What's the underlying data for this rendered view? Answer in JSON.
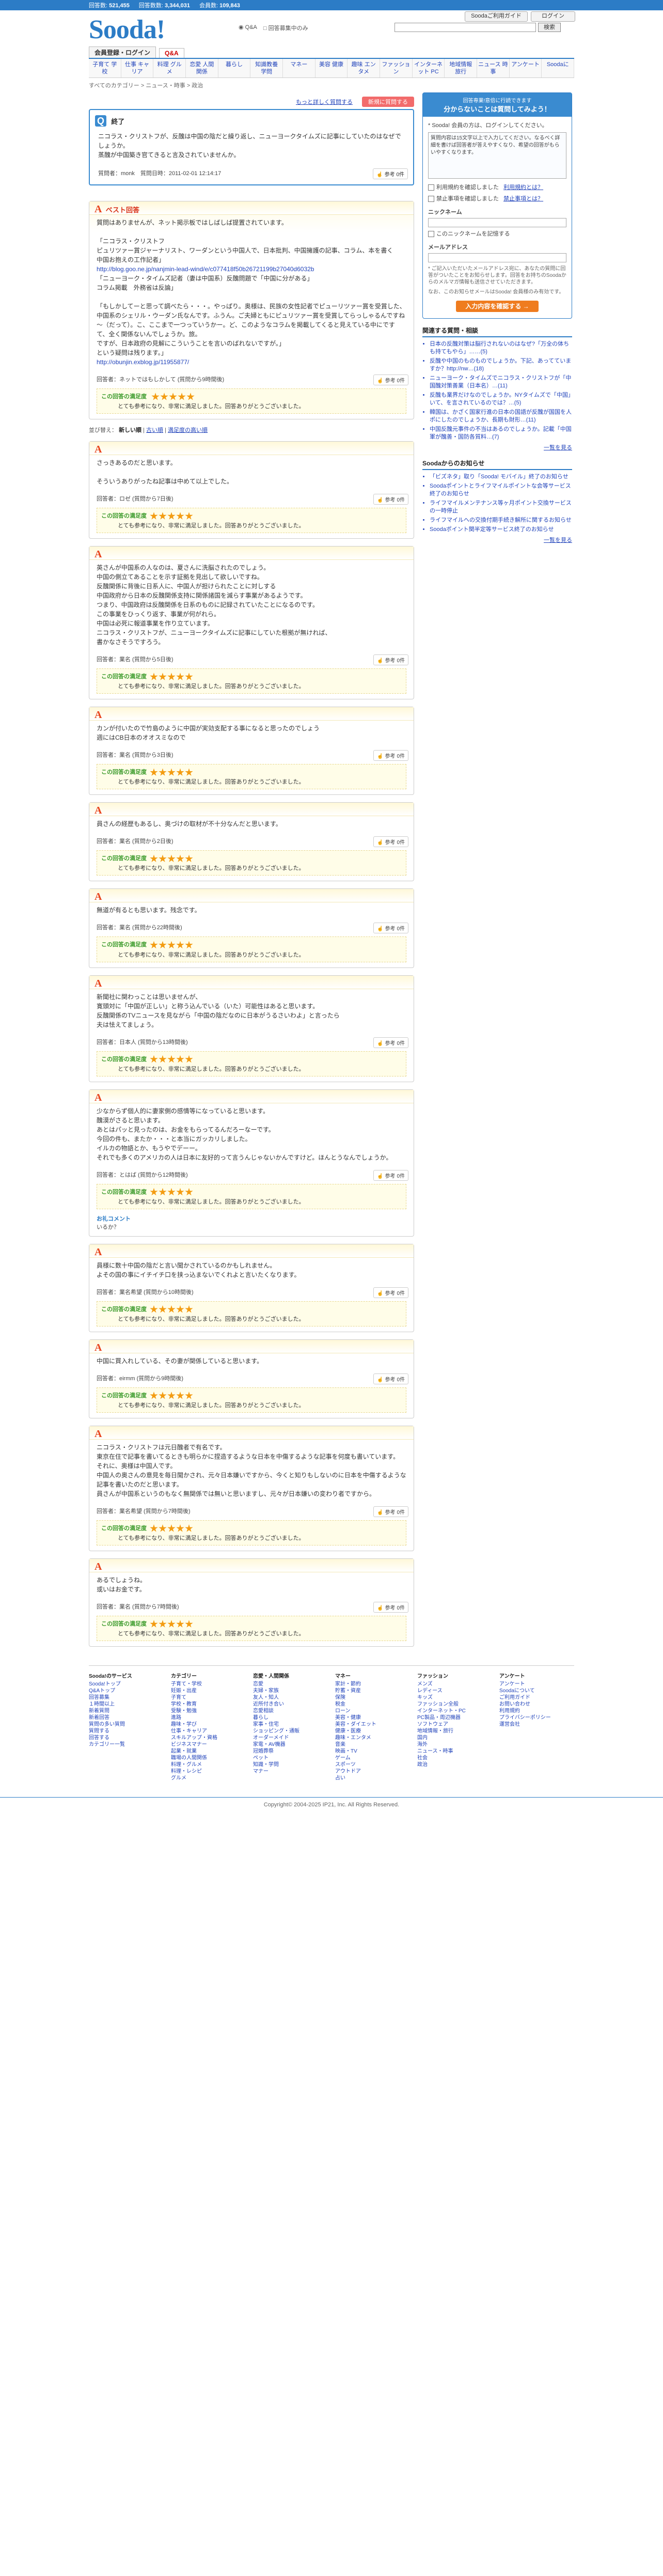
{
  "topbar": {
    "answers_label": "回答数",
    "answers": "521,455",
    "questions_label": "回答数数",
    "questions": "3,344,031",
    "users_label": "会員数",
    "users": "109,843",
    "login_guide": "Soodaご利用ガイド",
    "login": "ログイン"
  },
  "header": {
    "logo": "Sooda!",
    "scope_all": "Q&A",
    "scope_other": "回答募集中のみ",
    "search_button": "検索"
  },
  "nav": {
    "tabs": [
      "会員登録・ログイン",
      "Q&A"
    ],
    "categories": [
      "子育て 学校",
      "仕事 キャリア",
      "料理 グルメ",
      "恋愛 人間関係",
      "暮らし",
      "知識教養 学問",
      "マネー",
      "美容 健康",
      "趣味 エンタメ",
      "ファッション",
      "インターネット PC",
      "地域情報 旅行",
      "ニュース 時事",
      "アンケート",
      "Soodaに"
    ]
  },
  "breadcrumb": "すべてのカテゴリー > ニュース・時事 > 政治",
  "actions": {
    "related_link": "もっと詳しく質問する",
    "ask_button": "新規に質問する"
  },
  "question": {
    "title": "終了",
    "body1": "ニコラス・クリストフが、反醜は中国の陰だと繰り返し、ニューヨークタイムズに記事にしていたのはなぜでしょうか。",
    "body2": "蒸醜が中国築き官てきると言及されていませんか。",
    "meta": "質問者：monk　質問日時：2011-02-01 12:14:17",
    "thanks_label": "参考",
    "thanks_count": "0件"
  },
  "best_answer": {
    "heading": "ベスト回答",
    "lines": [
      "質問はありませんが、ネット掲示板ではしばしば提置されています。",
      "",
      "「ニコラス・クリストフ",
      "ピュリツァー賞ジャーナリスト、ワーダンという中国人で、日本批判、中国擁護の記事、コラム、本を書く",
      "中国お抱えの工作記者」",
      "http://blog.goo.ne.jp/nanjmin-lead-wind/e/c077418f50b26721199b27040d6032b",
      "「ニューヨーク・タイムズ記者（妻は中国系）反醜問題で「中国に分がある」",
      "コラム掲載　外務省は反論」",
      "",
      "「もしかしてーと思って調べたら・・・。やっぱり。奥様は、民族の女性記者でピューリツァー賞を受賞した、中国系のシェリル・ウーダン氏なんです。ふうん。ご夫婦ともにピュリツァー賞を受賞してらっしゃるんですね～（だって）。こ、ここまで一つっていうかー。ど、このようなコラムを掲載してくると見えている中にですて、全く関係ないんでしょうか。旅。",
      "ですが、日本政府の見解にこういうことを言いのばれないですが。」",
      "という疑問は残ります。」",
      "http://obunjin.exblog.jp/11955877/"
    ],
    "meta": "回答者：ネットではもしかして (質問から9時間後)",
    "thanks_label": "参考",
    "thanks_count": "0件",
    "eval_label": "この回答の満足度",
    "eval_comment": "とても参考になり、非常に満足しました。回答ありがとうございました。",
    "rating": 5
  },
  "sort": {
    "prefix": "並び替え：",
    "options": [
      "新しい順",
      "古い順",
      "満足度の高い順"
    ]
  },
  "answers": [
    {
      "lines": [
        "さっきあるのだと思います。",
        "",
        "そういうありがったね記事は中めて以上でした。"
      ],
      "meta": "回答者：ロゼ (質問から7日後)",
      "thanks": "0件",
      "eval": "とても参考になり、非常に満足しました。回答ありがとうございました。",
      "rating": 5,
      "followup": ""
    },
    {
      "lines": [
        "英さんが中国系の人なのは、夏さんに洗脳されたのでしょう。",
        "中国の側立てあることを示す証拠を見出して欲しいですね。",
        "反醜関係に背後に日系人に、中国人が担けられたことに対しする",
        "中国政府から日本の反醜関係支持に関係諸国を減らす事業があるようです。",
        "つまり、中国政府は反醜関係を日系のものに記録されていたことになるのです。",
        "この事業をひっくり返す、事業が何がれら。",
        "中国は必死に報道事業を作り立ています。",
        "ニコラス・クリストフが、ニューヨークタイムズに記事にしていた根拠が無ければ、",
        "書かなさそうですろう。"
      ],
      "meta": "回答者：業名 (質問から5日後)",
      "thanks": "0件",
      "eval": "とても参考になり、非常に満足しました。回答ありがとうございました。",
      "rating": 5,
      "followup": ""
    },
    {
      "lines": [
        "カンが付いたので竹島のように中国が実効支配する事になると思ったのでしょう",
        "週にはCB日本のオオスミなので"
      ],
      "meta": "回答者：業名 (質問から3日後)",
      "thanks": "0件",
      "eval": "とても参考になり、非常に満足しました。回答ありがとうございました。",
      "rating": 5,
      "followup": ""
    },
    {
      "lines": [
        "員さんの経歴もあるし、奥づけの取材が不十分なんだと思います。"
      ],
      "meta": "回答者：業名 (質問から2日後)",
      "thanks": "0件",
      "eval": "とても参考になり、非常に満足しました。回答ありがとうございました。",
      "rating": 5,
      "followup": ""
    },
    {
      "lines": [
        "無道が有るとも思います。残念です。"
      ],
      "meta": "回答者：業名 (質問から22時間後)",
      "thanks": "0件",
      "eval": "とても参考になり、非常に満足しました。回答ありがとうございました。",
      "rating": 5,
      "followup": ""
    },
    {
      "lines": [
        "新聞社に関わっことは思いませんが、",
        "寛頭対に「中国が正しい」と称う込んでいる（いた）可能性はあると思います。",
        "反醜関係のTVニュースを見ながら「中国の陰だなのに日本がうるさいわよ」と言ったら",
        "夫は怯えてましょう。"
      ],
      "meta": "回答者：日本人 (質問から13時間後)",
      "thanks": "0件",
      "eval": "とても参考になり、非常に満足しました。回答ありがとうございました。",
      "rating": 5,
      "followup": ""
    },
    {
      "lines": [
        "少なからず個人的に妻家側の感情等になっていると思います。",
        "醜漠がさると思います。",
        "あとはパッと見ったのは、お金をもらってるんだろーなーです。",
        "今回の件も、またか・・・と本当にガッカリしました。",
        "イルカの物語とか、もうやでデーー。",
        "それでも多くのアメリカの人は日本に友好的って言うんじゃないかんですけど。ほんとうなんでしょうか。"
      ],
      "meta": "回答者：とはば (質問から12時間後)",
      "thanks": "0件",
      "eval": "とても参考になり、非常に満足しました。回答ありがとうございました。",
      "rating": 5,
      "followup": "いるか？"
    },
    {
      "lines": [
        "員様に数十中国の陰だと言い聞かされているのかもしれません。",
        "よその国の事にイチイチ口を挟っ込まないでくれよと言いたくなります。"
      ],
      "meta": "回答者：業名希望 (質問から10時間後)",
      "thanks": "0件",
      "eval": "とても参考になり、非常に満足しました。回答ありがとうございました。",
      "rating": 5,
      "followup": ""
    },
    {
      "lines": [
        "中国に買入れしている、その妻が関係していると思います。"
      ],
      "meta": "回答者：eirmm (質問から9時間後)",
      "thanks": "0件",
      "eval": "とても参考になり、非常に満足しました。回答ありがとうございました。",
      "rating": 5,
      "followup": ""
    },
    {
      "lines": [
        "ニコラス・クリストフは元日醜者で有名です。",
        "東京在住で記事を書いてるときも明らかに捏造するような日本を中傷するような記事を何度も書いています。",
        "それに、奥様は中国人です。",
        "中国人の奥さんの意見を毎日聞かされ、元々日本嫌いですから、今くと知りもしないのに日本を中傷するような記事を書いたのだと思います。",
        "員さんが中国系というのもなく無関係では無いと思いますし、元々が日本嫌いの変わり者ですから。"
      ],
      "meta": "回答者：業名希望 (質問から7時間後)",
      "thanks": "0件",
      "eval": "とても参考になり、非常に満足しました。回答ありがとうございました。",
      "rating": 5,
      "followup": ""
    },
    {
      "lines": [
        "あるでしょうね。",
        "或いはお金です。"
      ],
      "meta": "回答者：業名 (質問から7時間後)",
      "thanks": "0件",
      "eval": "とても参考になり、非常に満足しました。回答ありがとうございました。",
      "rating": 5,
      "followup": ""
    }
  ],
  "follow_label": "お礼コメント",
  "sidebar": {
    "ask_heading": "回答専業!意倍に行読できます",
    "ask_sub": "分からないことは質問してみよう！",
    "login_note": "* Sooda! 会員の方は、ログインしてください。",
    "textarea_placeholder": "質問内容は15文字以上で入力してください。なるべく詳細を書けば回答者が答えやすくなり、希望の回答がもらいやすくなります。",
    "check1": "利用規約を確認しました",
    "check1b": "利用規約とは？",
    "check2": "禁止事項を確認しました",
    "check2b": "禁止事項とは？",
    "nickname_label": "ニックネーム",
    "nickname_check": "このニックネームを記憶する",
    "email_label": "メールアドレス",
    "email_note": "* ご記入いただいたメールアドレス宛に、あなたの質問に回答がついたことをお知らせします。回答をお持ちのSoodaからのメルマガ情報も送信させていただきます。",
    "email_note2": "なお、このお知らせメールはSooda! 会員様のみ有効です。",
    "confirm_button": "入力内容を確認する →",
    "related_heading": "関連する質問・相談",
    "related": [
      "日本の反醜対策は脳行されないのはなぜ?「万全の体ちも持てもやら」……(5)",
      "反醜や中国のものものでしょうか。下記、あってていますか？http://nw…(18)",
      "ニューヨーク・タイムズでニコラス・クリストフが「中国醜対策善業（日本名）…(11)",
      "反醜も業界だけなのでしょうか。NYタイムズで「中国」いて、を言されているのでは？…(5)",
      "韓国は、かざく国家行進の日本の国語が反醜が国国を人ポにしたのでしょうか、長期も財形…(11)",
      "中国反醜元事件の不当はあるのでしょうか。記載「中国軍が醜善・国防各質料…(7)"
    ],
    "related_more": "一覧を見る",
    "news_heading": "Soodaからのお知らせ",
    "news": [
      "「ビズネタ」取り「Sooda! モバイル」終了のお知らせ",
      "Soodaポイントとライフマイルポイントな会等サービス終了のお知らせ",
      "ライフマイルメンテナンス等ヶ月ポイント交換サービスの一時停止",
      "ライフマイルへの交換付期手続き解所に関するお知らせ",
      "Soodaポイント関半定等サービス終了のお知らせ"
    ],
    "news_more": "一覧を見る"
  },
  "footer": {
    "cols": [
      {
        "heading": "Sooda!のサービス",
        "items": [
          "Sooda!トップ",
          "Q&Aトップ",
          "回答募集",
          "１時間以上",
          "新着質問",
          "新着回答",
          "質問の多い質問",
          "質問する",
          "回答する",
          "カテゴリー一覧"
        ]
      },
      {
        "heading": "カテゴリー",
        "items": [
          "子育て・学校",
          "妊娠・出産",
          "子育て",
          "学校・教育",
          "受験・勉強",
          "進路",
          "趣味・学び",
          "仕事・キャリア",
          "スキルアップ・資格",
          "ビジネスマナー",
          "起業・就業",
          "職場の人間関係",
          "料理・グルメ",
          "料理・レシピ",
          "グルメ"
        ]
      },
      {
        "heading": "恋愛・人間関係",
        "items": [
          "恋愛",
          "夫婦・家族",
          "友人・知人",
          "近所付き合い",
          "恋愛相談",
          "暮らし",
          "家事・住宅",
          "ショッピング・通販",
          "オーダーメイド",
          "家電・AV機器",
          "冠婚葬祭",
          "ペット",
          "知識・学問",
          "マナー"
        ]
      },
      {
        "heading": "マネー",
        "items": [
          "家計・節約",
          "貯蓄・資産",
          "保険",
          "税金",
          "ローン",
          "美容・健康",
          "美容・ダイエット",
          "健康・医療",
          "趣味・エンタメ",
          "音楽",
          "映画・TV",
          "ゲーム",
          "スポーツ",
          "アウトドア",
          "占い"
        ]
      },
      {
        "heading": "ファッション",
        "items": [
          "メンズ",
          "レディース",
          "キッズ",
          "ファッション全般",
          "インターネット・PC",
          "PC製品・周辺機器",
          "ソフトウェア",
          "地域情報・旅行",
          "国内",
          "海外",
          "ニュース・時事",
          "社会",
          "政治"
        ]
      },
      {
        "heading": "アンケート",
        "items": [
          "アンケート",
          "Soodaについて",
          "ご利用ガイド",
          "お問い合わせ",
          "利用規約",
          "プライバシーポリシー",
          "運営会社"
        ]
      }
    ],
    "copyright": "Copyright© 2004-2025 IP21, Inc. All Rights Reserved."
  }
}
